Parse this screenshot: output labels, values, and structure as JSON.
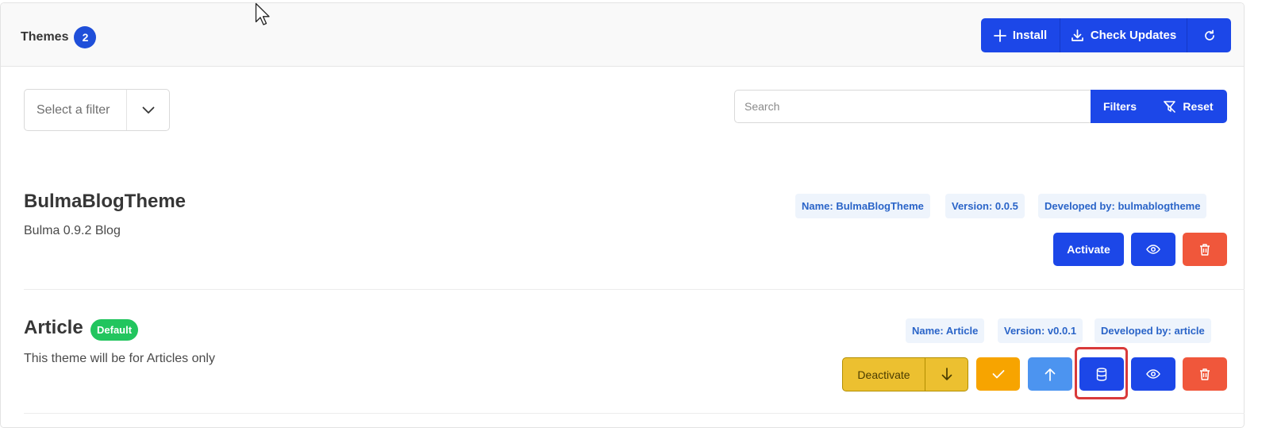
{
  "header": {
    "title": "Themes",
    "count": "2",
    "install_label": "Install",
    "check_updates_label": "Check Updates"
  },
  "toolbar": {
    "filter_select_value": "Select a filter",
    "search_placeholder": "Search",
    "filters_label": "Filters",
    "reset_label": "Reset"
  },
  "themes": [
    {
      "name": "BulmaBlogTheme",
      "description": "Bulma 0.9.2 Blog",
      "meta_name": "Name: BulmaBlogTheme",
      "meta_version": "Version: 0.0.5",
      "meta_developer": "Developed by: bulmablogtheme",
      "activate_label": "Activate"
    },
    {
      "name": "Article",
      "tag": "Default",
      "description": "This theme will be for Articles only",
      "meta_name": "Name: Article",
      "meta_version": "Version: v0.0.1",
      "meta_developer": "Developed by: article",
      "deactivate_label": "Deactivate"
    }
  ],
  "colors": {
    "primary": "#1c47e8",
    "danger": "#f0573b",
    "warning": "#f7a400",
    "info": "#4c94f0",
    "success": "#22c55e",
    "deactivate": "#ecc030"
  },
  "icons": {
    "install": "plus-icon",
    "check_updates": "download-icon",
    "refresh": "refresh-icon",
    "filter_chevron": "chevron-down-icon",
    "reset": "filter-off-icon",
    "preview": "eye-icon",
    "delete": "trash-icon",
    "move_down": "arrow-down-icon",
    "set_default": "check-icon",
    "move_up": "arrow-up-icon",
    "database": "database-icon"
  }
}
